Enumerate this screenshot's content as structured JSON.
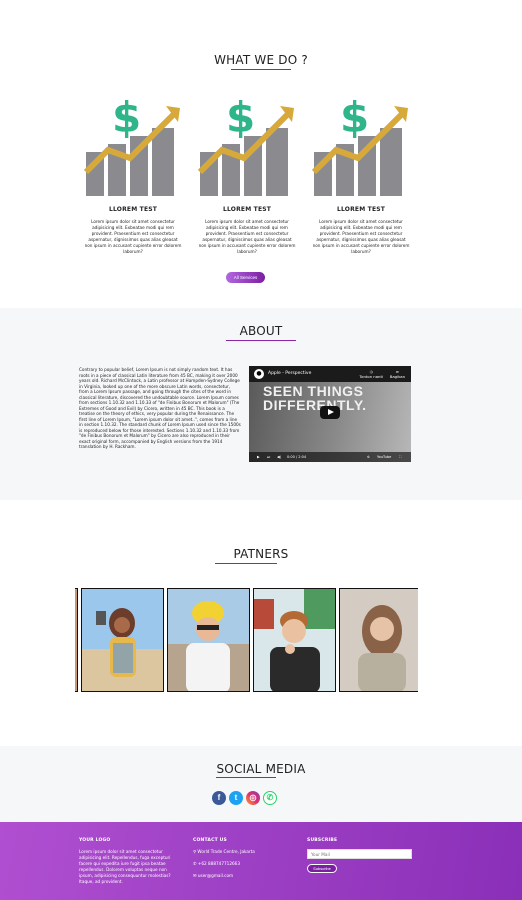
{
  "what_we_do": {
    "title": "WHAT WE DO ?",
    "cards": [
      {
        "title": "LLOREM TEST",
        "text": "Lorem ipsum dolor sit amet consectetur adipisicing elit. Exbeatae modi qui rem provident. Praesentium est consectetur aspernatur, dignissimos quas alias gleasat non ipsum in accusant cupiente error dolorem laborum?"
      },
      {
        "title": "LLOREM TEST",
        "text": "Lorem ipsum dolor sit amet consectetur adipisicing elit. Exbeatae modi qui rem provident. Praesentium est consectetur aspernatur, dignissimos quas alias gleasat non ipsum in accusant cupiente error dolorem laborum?"
      },
      {
        "title": "LLOREM TEST",
        "text": "Lorem ipsum dolor sit amet consectetur adipisicing elit. Exbeatae modi qui rem provident. Praesentium est consectetur aspernatur, dignissimos quas alias gleasat non ipsum in accusant cupiente error dolorem laborum?"
      }
    ],
    "button": "All Services"
  },
  "about": {
    "title": "ABOUT",
    "text": "Contrary to popular belief, Lorem Ipsum is not simply random text. It has roots in a piece of classical Latin literature from 45 BC, making it over 2000 years old. Richard McClintock, a Latin professor at Hampden-Sydney College in Virginia, looked up one of the more obscure Latin words, consectetur, from a Lorem Ipsum passage, and going through the cites of the word in classical literature, discovered the undoubtable source. Lorem Ipsum comes from sections 1.10.32 and 1.10.33 of \"de Finibus Bonorum et Malorum\" (The Extremes of Good and Evil) by Cicero, written in 45 BC. This book is a treatise on the theory of ethics, very popular during the Renaissance. The first line of Lorem Ipsum, \"Lorem ipsum dolor sit amet..\", comes from a line in section 1.10.32. The standard chunk of Lorem Ipsum used since the 1500s is reproduced below for those interested. Sections 1.10.32 and 1.10.33 from \"de Finibus Bonorum et Malorum\" by Cicero are also reproduced in their exact original form, accompanied by English versions from the 1914 translation by H. Rackham.",
    "video": {
      "title": "Apple - Perspective",
      "watch_later": "Tonton nanti",
      "share": "Bagikan",
      "headline": "SEEN THINGS DIFFERENTLY.",
      "time": "0:00 / 2:04",
      "brand": "YouTube"
    }
  },
  "partners": {
    "title": "PATNERS"
  },
  "social": {
    "title": "SOCIAL MEDIA",
    "icons": [
      "facebook-icon",
      "twitter-icon",
      "instagram-icon",
      "whatsapp-icon"
    ]
  },
  "footer": {
    "logo_heading": "YOUR LOGO",
    "logo_text": "Lorem ipsum dolor sit amet consectetur adipisicing elit. Repellendus, fuga excepturi facere qui expedita iure fugit ipsa beatae repellendus. Dolorem voluptas neque non ipsum, adipisicing consequuntur molestias? Itaque, ad provident.",
    "contact_heading": "CONTACT US",
    "address": "World Trade Centre, Jakarta",
    "phone": "+62 888747712663",
    "email": "user@gmail.com",
    "subscribe_heading": "SUBSCRIBE",
    "mail_placeholder": "Your Mail",
    "subscribe_button": "Subscribe"
  },
  "colors": {
    "accent": "#8e24aa",
    "footer_start": "#b04fd0",
    "footer_end": "#8a2fb8"
  }
}
